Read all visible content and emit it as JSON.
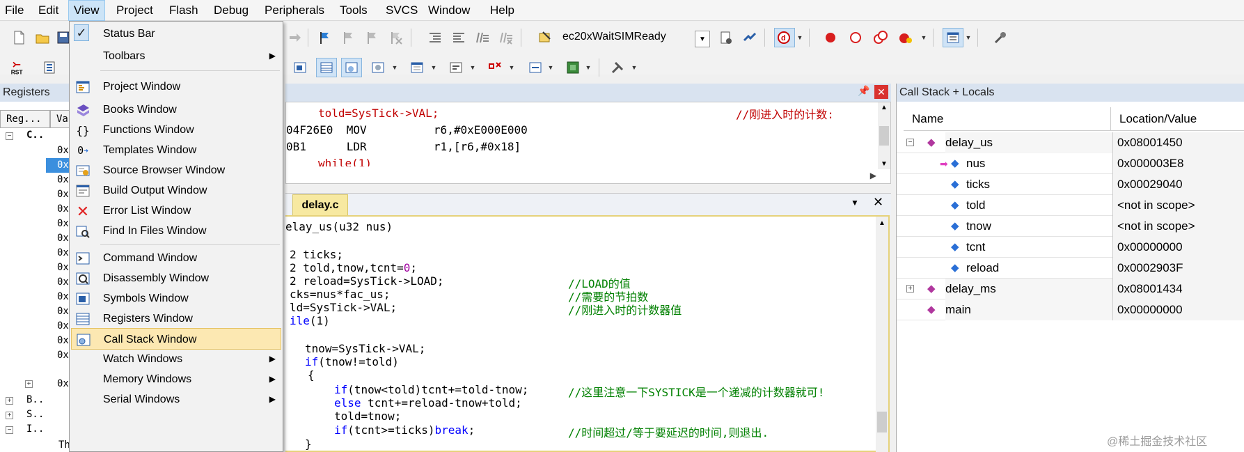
{
  "menubar": {
    "items": [
      "File",
      "Edit",
      "View",
      "Project",
      "Flash",
      "Debug",
      "Peripherals",
      "Tools",
      "SVCS",
      "Window",
      "Help"
    ]
  },
  "toolbar": {
    "target": "ec20xWaitSIMReady",
    "rst_label": "RST"
  },
  "view_menu": {
    "items": [
      {
        "label": "Status Bar",
        "checked": true
      },
      {
        "label": "Toolbars",
        "submenu": true
      },
      {
        "label": "Project Window",
        "icon": "project-window-icon"
      },
      {
        "label": "Books Window",
        "icon": "books-icon"
      },
      {
        "label": "Functions Window",
        "icon": "functions-icon"
      },
      {
        "label": "Templates Window",
        "icon": "templates-icon"
      },
      {
        "label": "Source Browser Window",
        "icon": "source-browser-icon"
      },
      {
        "label": "Build Output Window",
        "icon": "build-output-icon"
      },
      {
        "label": "Error List Window",
        "icon": "error-list-icon"
      },
      {
        "label": "Find In Files Window",
        "icon": "find-in-files-icon"
      },
      {
        "label": "Command Window",
        "icon": "command-icon"
      },
      {
        "label": "Disassembly Window",
        "icon": "disassembly-icon"
      },
      {
        "label": "Symbols Window",
        "icon": "symbols-icon"
      },
      {
        "label": "Registers Window",
        "icon": "registers-icon"
      },
      {
        "label": "Call Stack Window",
        "icon": "call-stack-icon",
        "highlighted": true
      },
      {
        "label": "Watch Windows",
        "submenu": true
      },
      {
        "label": "Memory Windows",
        "submenu": true
      },
      {
        "label": "Serial Windows",
        "submenu": true
      }
    ]
  },
  "registers": {
    "title": "Registers",
    "col_register": "Reg...",
    "col_value": "Va",
    "root": "C..",
    "rows": [
      "0x",
      "0x",
      "0x",
      "0x",
      "0x",
      "0x",
      "0x",
      "0x",
      "0x",
      "0x",
      "0x",
      "0x",
      "0x",
      "0x",
      "0x",
      "0x"
    ],
    "groups": [
      "B..",
      "S..",
      "I.."
    ],
    "last": "Th"
  },
  "disassembly": {
    "lines": [
      "told=SysTick->VAL;",
      "//刚进入时的计数:",
      "04F26E0  MOV          r6,#0xE000E000",
      "0B1      LDR          r1,[r6,#0x18]",
      "while(1)"
    ]
  },
  "editor": {
    "tab": "delay.c",
    "lines": {
      "l1": "elay_us(u32 nus)",
      "l2a": "2 ticks;",
      "l3a": "2 told,tnow,tcnt=",
      "l3b": "0",
      "l3c": ";",
      "l4a": "2 reload=SysTick->LOAD;",
      "l4c": "//LOAD的值",
      "l5a": "cks=nus*fac_us;",
      "l5c": "//需要的节拍数",
      "l6a": "ld=SysTick->VAL;",
      "l6c": "//刚进入时的计数器值",
      "l7a": "ile",
      "l7b": "(1)",
      "l8": "tnow=SysTick->VAL;",
      "l9a": "if",
      "l9b": "(tnow!=told)",
      "l10": "{",
      "l11a": "if",
      "l11b": "(tnow<told)tcnt+=told-tnow;",
      "l11c": "//这里注意一下SYSTICK是一个递减的计数器就可!",
      "l12a": "else",
      "l12b": " tcnt+=reload-tnow+told;",
      "l13": "told=tnow;",
      "l14a": "if",
      "l14b": "(tcnt>=ticks)",
      "l14d": "break",
      "l14e": ";",
      "l14c": "//时间超过/等于要延迟的时间,则退出.",
      "l15": "}"
    }
  },
  "callstack": {
    "title": "Call Stack + Locals",
    "col_name": "Name",
    "col_value": "Location/Value",
    "rows": [
      {
        "name": "delay_us",
        "value": "0x08001450"
      },
      {
        "name": "nus",
        "value": "0x000003E8"
      },
      {
        "name": "ticks",
        "value": "0x00029040"
      },
      {
        "name": "told",
        "value": "<not in scope>"
      },
      {
        "name": "tnow",
        "value": "<not in scope>"
      },
      {
        "name": "tcnt",
        "value": "0x00000000"
      },
      {
        "name": "reload",
        "value": "0x0002903F"
      },
      {
        "name": "delay_ms",
        "value": "0x08001434"
      },
      {
        "name": "main",
        "value": "0x00000000"
      }
    ]
  },
  "watermark": "@稀土掘金技术社区"
}
